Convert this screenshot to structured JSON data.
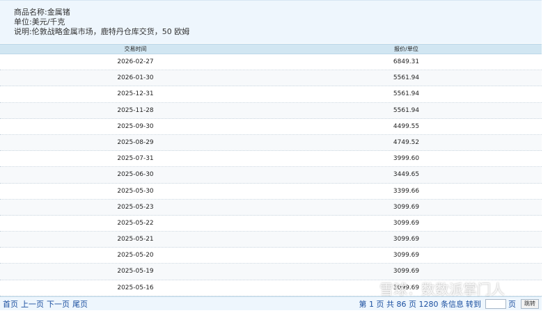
{
  "info": {
    "name_line": "商品名称:金属锗",
    "unit_line": "单位:美元/千克",
    "desc_line": "说明:伦敦战略金属市场，鹿特丹仓库交货，50 欧姆"
  },
  "table": {
    "headers": [
      "交易时间",
      "报价/单位"
    ],
    "rows": [
      [
        "2026-02-27",
        "6849.31"
      ],
      [
        "2026-01-30",
        "5561.94"
      ],
      [
        "2025-12-31",
        "5561.94"
      ],
      [
        "2025-11-28",
        "5561.94"
      ],
      [
        "2025-09-30",
        "4499.55"
      ],
      [
        "2025-08-29",
        "4749.52"
      ],
      [
        "2025-07-31",
        "3999.60"
      ],
      [
        "2025-06-30",
        "3449.65"
      ],
      [
        "2025-05-30",
        "3399.66"
      ],
      [
        "2025-05-23",
        "3099.69"
      ],
      [
        "2025-05-22",
        "3099.69"
      ],
      [
        "2025-05-21",
        "3099.69"
      ],
      [
        "2025-05-20",
        "3099.69"
      ],
      [
        "2025-05-19",
        "3099.69"
      ],
      [
        "2025-05-16",
        "3099.69"
      ]
    ]
  },
  "pager": {
    "first": "首页",
    "prev": "上一页",
    "next": "下一页",
    "last": "尾页",
    "status": "第 1 页 共 86 页 1280 条信息",
    "goto": "转到",
    "page_suffix": "页",
    "jump": "跳转"
  },
  "watermark": "雪球：数数派掌门人"
}
